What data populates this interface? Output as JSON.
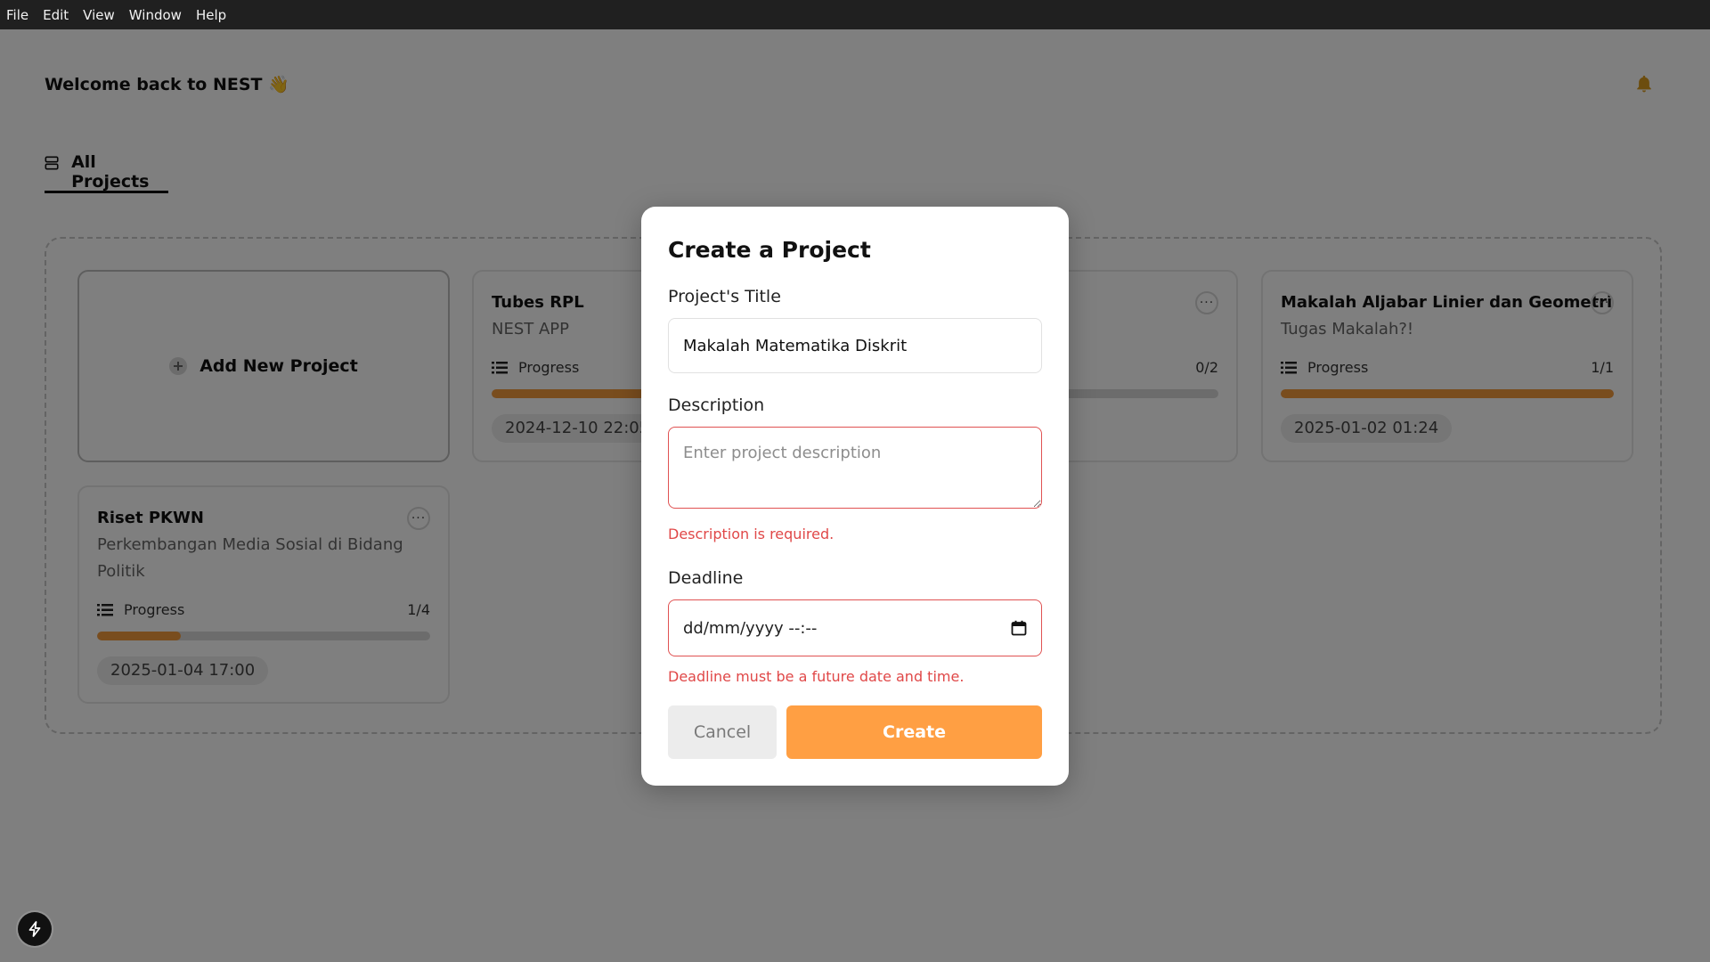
{
  "menubar": {
    "items": [
      "File",
      "Edit",
      "View",
      "Window",
      "Help"
    ]
  },
  "header": {
    "welcome": "Welcome back to NEST 👋",
    "bell_icon": "bell-icon",
    "bell_color": "#d99a1c"
  },
  "tabs": {
    "all_projects": "All Projects"
  },
  "add_card": {
    "label": "Add New Project"
  },
  "cards": [
    {
      "title": "Tubes RPL",
      "description": "NEST APP",
      "progress_label": "Progress",
      "count": "0/2",
      "progress": 0.55,
      "date": "2024-12-10 22:05"
    },
    {
      "title": "Makalah Aljabar Linier dan Geometri",
      "description": "Tugas Makalah?!",
      "progress_label": "Progress",
      "count": "1/1",
      "progress": 1.0,
      "date": "2025-01-02 01:24"
    },
    {
      "title": "Riset PKWN",
      "description": "Perkembangan Media Sosial di Bidang Politik",
      "progress_label": "Progress",
      "count": "1/4",
      "progress": 0.25,
      "date": "2025-01-04 17:00"
    }
  ],
  "modal": {
    "title": "Create a Project",
    "title_label": "Project's Title",
    "title_value": "Makalah Matematika Diskrit",
    "description_label": "Description",
    "description_placeholder": "Enter project description",
    "description_error": "Description is required.",
    "deadline_label": "Deadline",
    "deadline_placeholder": "dd/mm/yyyy --:--",
    "deadline_error": "Deadline must be a future date and time.",
    "cancel": "Cancel",
    "create": "Create"
  },
  "colors": {
    "accent": "#ff9f43",
    "progress_fill": "#f29a3d",
    "error": "#e04848"
  }
}
